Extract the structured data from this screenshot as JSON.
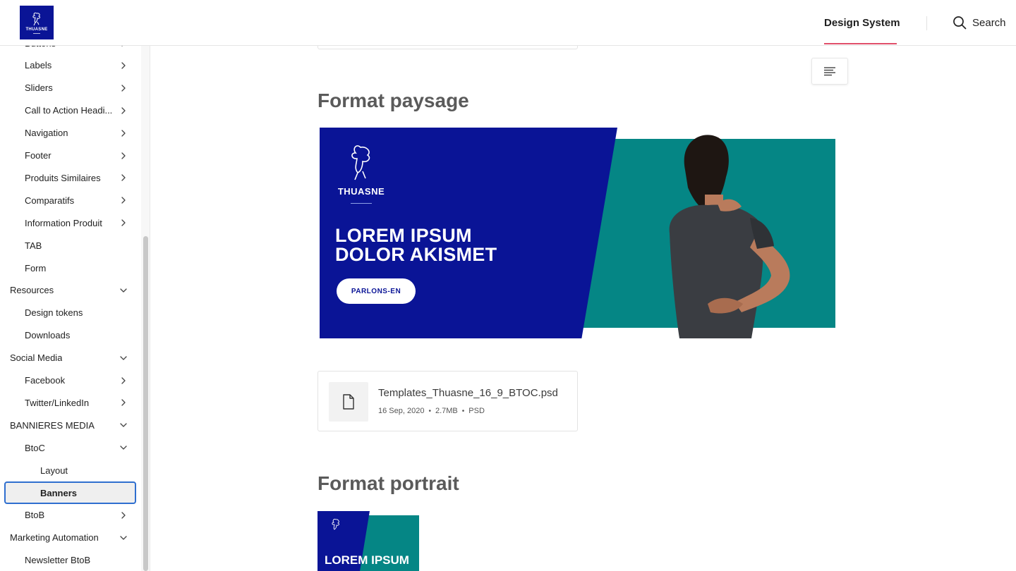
{
  "header": {
    "logo_text": "THUASNE",
    "nav_tab": "Design System",
    "search_label": "Search"
  },
  "sidebar": {
    "items": [
      {
        "label": "Buttons",
        "level": 1,
        "chevron": "right"
      },
      {
        "label": "Labels",
        "level": 1,
        "chevron": "right"
      },
      {
        "label": "Sliders",
        "level": 1,
        "chevron": "right"
      },
      {
        "label": "Call to Action Headi...",
        "level": 1,
        "chevron": "right"
      },
      {
        "label": "Navigation",
        "level": 1,
        "chevron": "right"
      },
      {
        "label": "Footer",
        "level": 1,
        "chevron": "right"
      },
      {
        "label": "Produits Similaires",
        "level": 1,
        "chevron": "right"
      },
      {
        "label": "Comparatifs",
        "level": 1,
        "chevron": "right"
      },
      {
        "label": "Information Produit",
        "level": 1,
        "chevron": "right"
      },
      {
        "label": "TAB",
        "level": 1,
        "chevron": "none"
      },
      {
        "label": "Form",
        "level": 1,
        "chevron": "none"
      },
      {
        "label": "Resources",
        "level": 0,
        "chevron": "down"
      },
      {
        "label": "Design tokens",
        "level": 1,
        "chevron": "none"
      },
      {
        "label": "Downloads",
        "level": 1,
        "chevron": "none"
      },
      {
        "label": "Social Media",
        "level": 0,
        "chevron": "down"
      },
      {
        "label": "Facebook",
        "level": 1,
        "chevron": "right"
      },
      {
        "label": "Twitter/LinkedIn",
        "level": 1,
        "chevron": "right"
      },
      {
        "label": "BANNIERES MEDIA",
        "level": 0,
        "chevron": "down"
      },
      {
        "label": "BtoC",
        "level": 1,
        "chevron": "down"
      },
      {
        "label": "Layout",
        "level": 2,
        "chevron": "none"
      },
      {
        "label": "Banners",
        "level": 2,
        "chevron": "none",
        "active": true
      },
      {
        "label": "BtoB",
        "level": 1,
        "chevron": "right"
      },
      {
        "label": "Marketing Automation",
        "level": 0,
        "chevron": "down"
      },
      {
        "label": "Newsletter BtoB",
        "level": 1,
        "chevron": "none"
      }
    ]
  },
  "main": {
    "section_landscape_title": "Format paysage",
    "section_portrait_title": "Format portrait",
    "banner": {
      "logo_text": "THUASNE",
      "headline_line1": "LOREM IPSUM",
      "headline_line2": "DOLOR AKISMET",
      "cta_label": "PARLONS-EN"
    },
    "file": {
      "name": "Templates_Thuasne_16_9_BTOC.psd",
      "date": "16 Sep, 2020",
      "size": "2.7MB",
      "type": "PSD"
    },
    "portrait": {
      "headline": "LOREM IPSUM"
    }
  },
  "colors": {
    "brand_blue": "#0a1496",
    "brand_teal": "#058685",
    "nav_underline": "#e0506a",
    "active_border": "#2f6fcf"
  }
}
